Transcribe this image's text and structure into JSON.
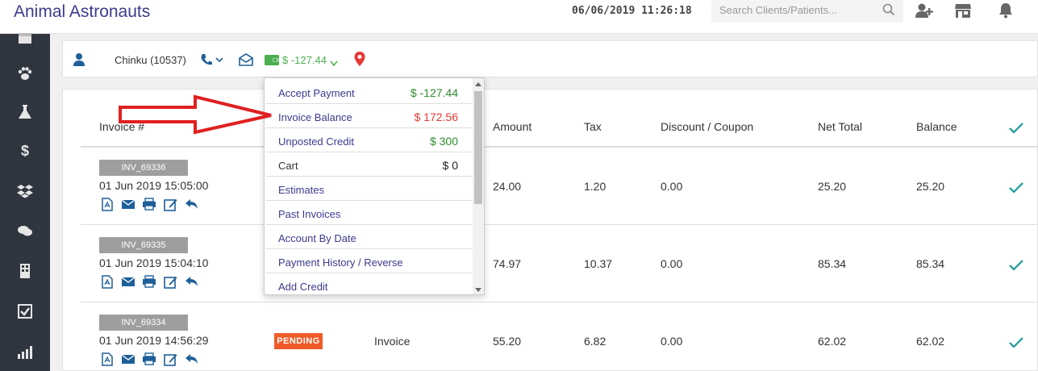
{
  "app": {
    "title": "Animal Astronauts"
  },
  "header": {
    "datetime": "06/06/2019 11:26:18",
    "search_placeholder": "Search Clients/Patients..."
  },
  "sidebar": {
    "items": [
      {
        "icon": "calendar-icon"
      },
      {
        "icon": "paw-icon"
      },
      {
        "icon": "flask-icon"
      },
      {
        "icon": "dollar-icon"
      },
      {
        "icon": "dropbox-icon"
      },
      {
        "icon": "chat-icon"
      },
      {
        "icon": "building-icon"
      },
      {
        "icon": "checklist-icon"
      },
      {
        "icon": "chart-icon"
      }
    ]
  },
  "client": {
    "name": "Chinku (10537)",
    "balance": "$ -127.44"
  },
  "table": {
    "headers": {
      "invoice": "Invoice #",
      "amount": "Amount",
      "tax": "Tax",
      "discount": "Discount / Coupon",
      "net_total": "Net Total",
      "balance": "Balance"
    },
    "rows": [
      {
        "id": "INV_69336",
        "date": "01 Jun 2019 15:05:00",
        "status": "",
        "type": "",
        "amount": "24.00",
        "tax": "1.20",
        "discount": "0.00",
        "net_total": "25.20",
        "balance": "25.20"
      },
      {
        "id": "INV_69335",
        "date": "01 Jun 2019 15:04:10",
        "status": "",
        "type": "",
        "amount": "74.97",
        "tax": "10.37",
        "discount": "0.00",
        "net_total": "85.34",
        "balance": "85.34"
      },
      {
        "id": "INV_69334",
        "date": "01 Jun 2019 14:56:29",
        "status": "PENDING",
        "type": "Invoice",
        "amount": "55.20",
        "tax": "6.82",
        "discount": "0.00",
        "net_total": "62.02",
        "balance": "62.02"
      }
    ]
  },
  "dropdown": {
    "items": [
      {
        "label": "Accept Payment",
        "value": "$ -127.44",
        "color": "#2e8b2e"
      },
      {
        "label": "Invoice Balance",
        "value": "$ 172.56",
        "color": "#e53935"
      },
      {
        "label": "Unposted Credit",
        "value": "$ 300",
        "color": "#2e8b2e"
      },
      {
        "label": "Cart",
        "value": "$ 0",
        "color": "#222222"
      },
      {
        "label": "Estimates",
        "value": ""
      },
      {
        "label": "Past Invoices",
        "value": ""
      },
      {
        "label": "Account By Date",
        "value": ""
      },
      {
        "label": "Payment History / Reverse",
        "value": ""
      },
      {
        "label": "Add Credit",
        "value": ""
      }
    ]
  },
  "colors": {
    "brand": "#3b3b8f",
    "sidebar_bg": "#2f3640",
    "accent_blue": "#1f5f99",
    "pending": "#f05a28",
    "check": "#1a9a9a",
    "annotation_arrow": "#e02020"
  }
}
